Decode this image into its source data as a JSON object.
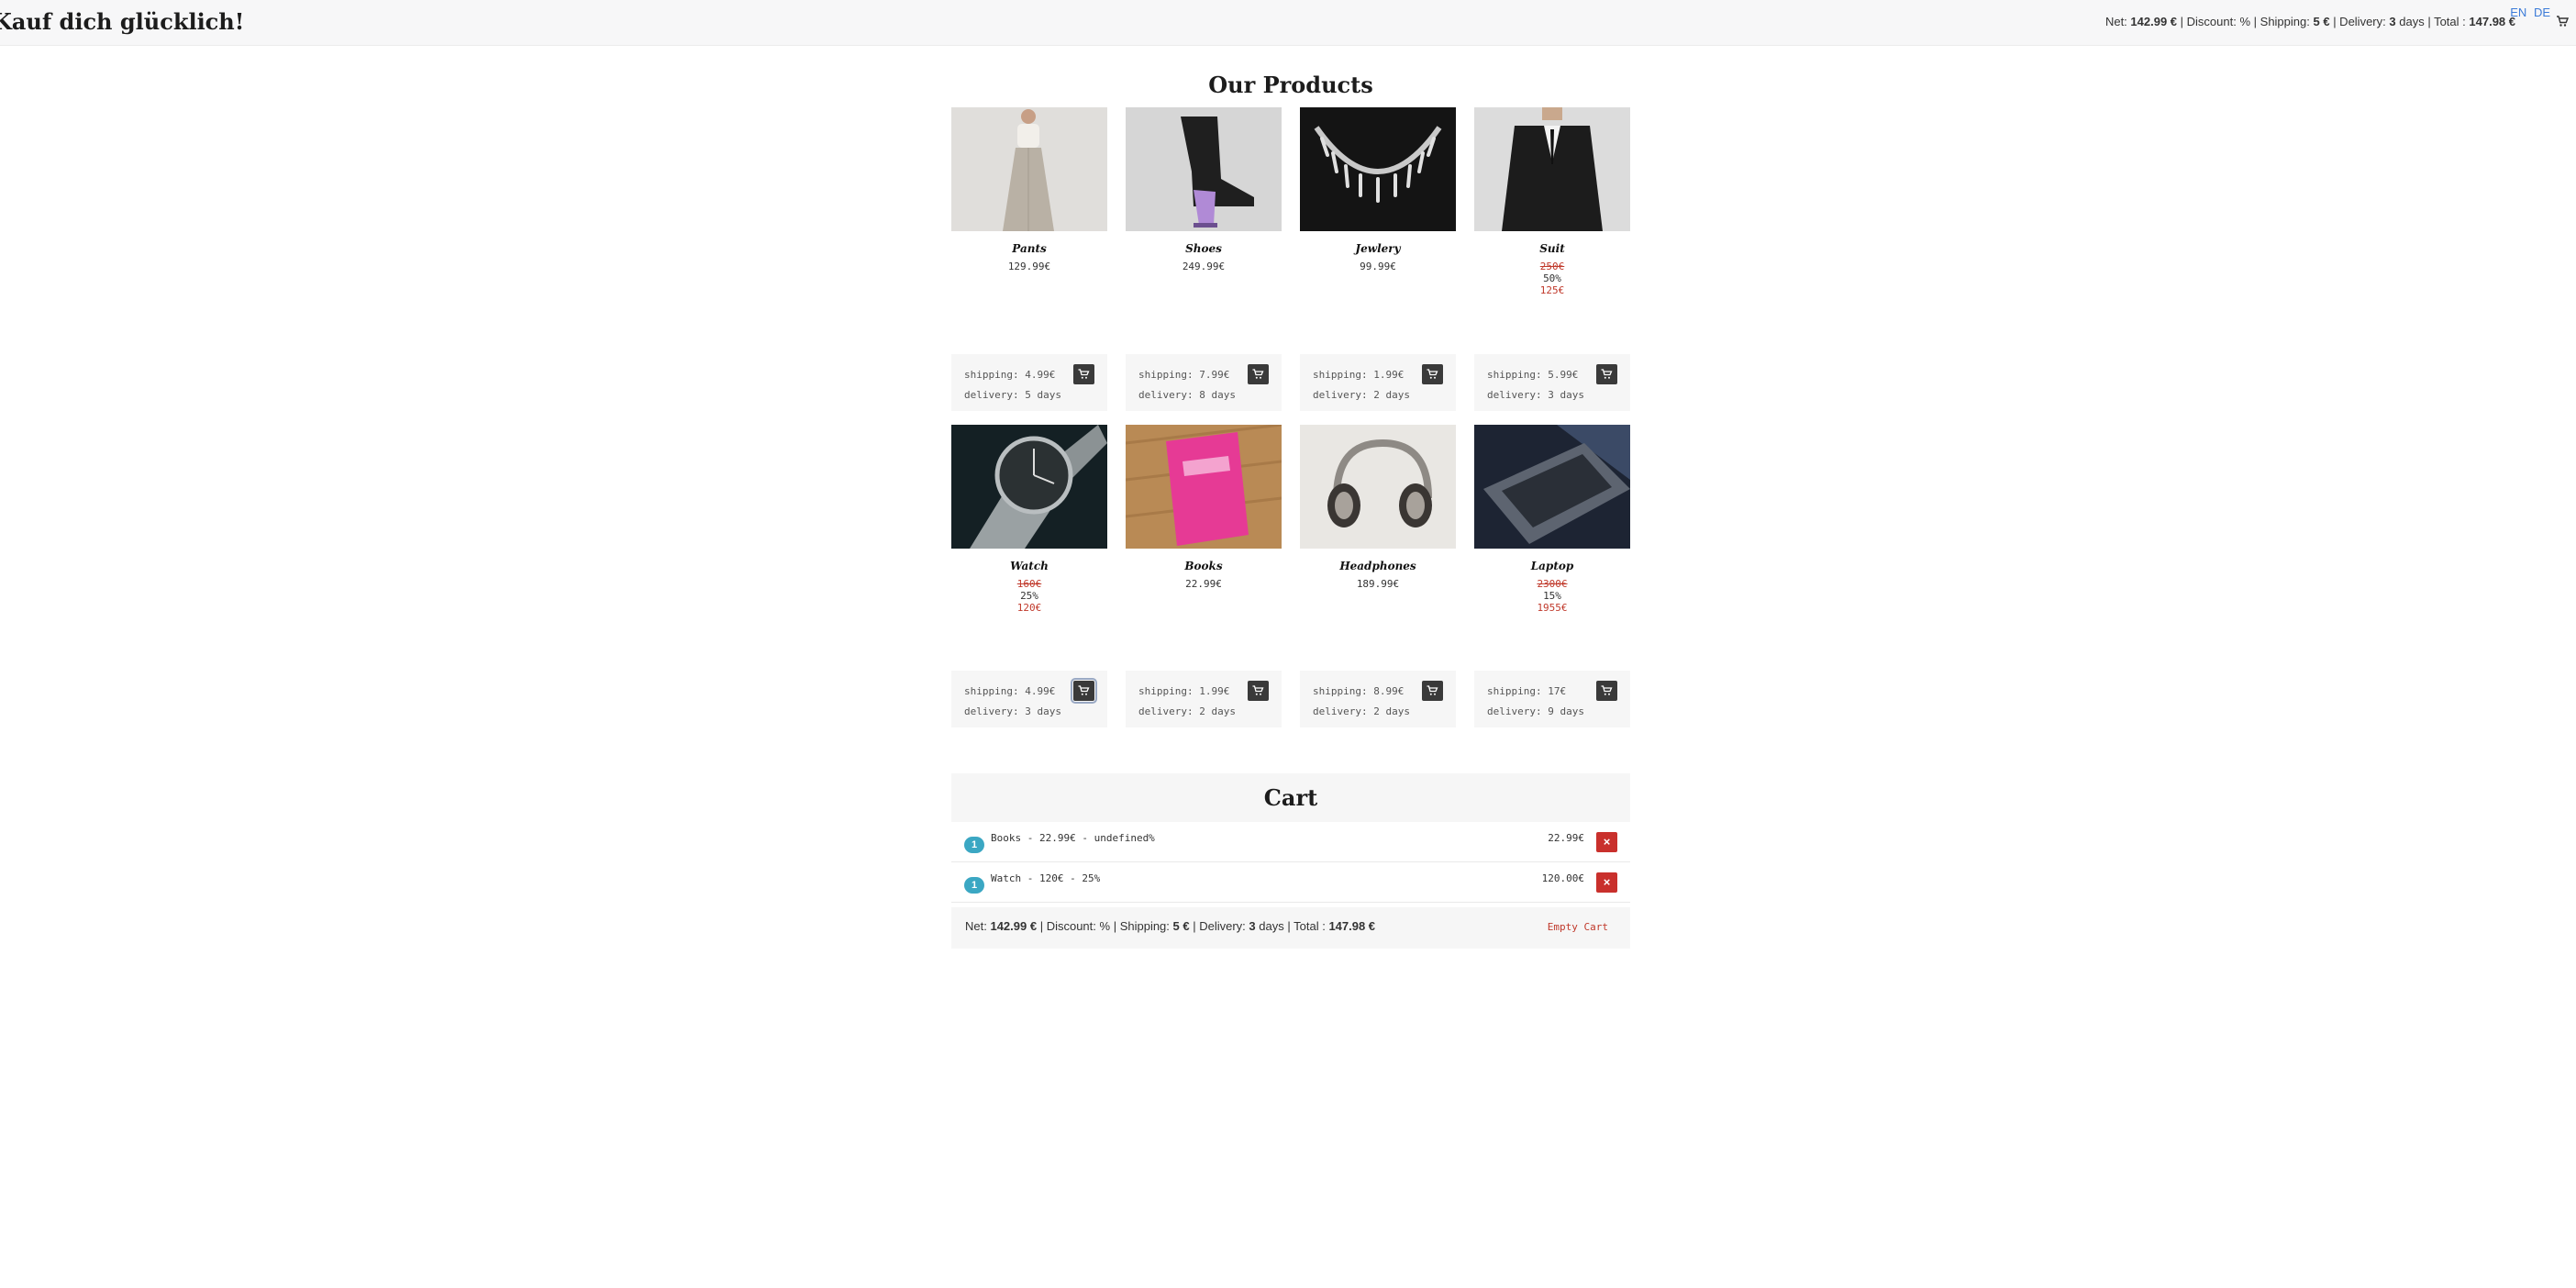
{
  "header": {
    "brand": "Kauf dich glücklich!",
    "summary": {
      "net_label": "Net:",
      "net_value": "142.99 €",
      "discount_label": "| Discount:",
      "discount_value": "%",
      "shipping_label": "| Shipping:",
      "shipping_value": "5 €",
      "delivery_label": "| Delivery:",
      "delivery_value": "3",
      "delivery_unit": "days",
      "total_label": "| Total :",
      "total_value": "147.98 €"
    },
    "languages": [
      "EN",
      "DE"
    ],
    "cart_icon": "shopping-cart-icon"
  },
  "products_heading": "Our Products",
  "products": [
    {
      "name": "Pants",
      "price": "129.99€",
      "shipping": "shipping: 4.99€",
      "delivery": "delivery: 5 days",
      "image": "pants-photo"
    },
    {
      "name": "Shoes",
      "price": "249.99€",
      "shipping": "shipping: 7.99€",
      "delivery": "delivery: 8 days",
      "image": "shoes-photo"
    },
    {
      "name": "Jewlery",
      "price": "99.99€",
      "shipping": "shipping: 1.99€",
      "delivery": "delivery: 2 days",
      "image": "necklace-photo"
    },
    {
      "name": "Suit",
      "old_price": "250€",
      "discount": "50%",
      "new_price": "125€",
      "shipping": "shipping: 5.99€",
      "delivery": "delivery: 3 days",
      "image": "suit-photo"
    },
    {
      "name": "Watch",
      "old_price": "160€",
      "discount": "25%",
      "new_price": "120€",
      "shipping": "shipping: 4.99€",
      "delivery": "delivery: 3 days",
      "image": "watch-photo"
    },
    {
      "name": "Books",
      "price": "22.99€",
      "shipping": "shipping: 1.99€",
      "delivery": "delivery: 2 days",
      "image": "book-photo"
    },
    {
      "name": "Headphones",
      "price": "189.99€",
      "shipping": "shipping: 8.99€",
      "delivery": "delivery: 2 days",
      "image": "headphones-photo"
    },
    {
      "name": "Laptop",
      "old_price": "2300€",
      "discount": "15%",
      "new_price": "1955€",
      "shipping": "shipping: 17€",
      "delivery": "delivery: 9 days",
      "image": "laptop-photo"
    }
  ],
  "cart": {
    "title": "Cart",
    "items": [
      {
        "qty": "1",
        "desc": "Books - 22.99€ - undefined%",
        "total": "22.99€"
      },
      {
        "qty": "1",
        "desc": "Watch - 120€ - 25%",
        "total": "120.00€"
      }
    ],
    "footer": {
      "net_label": "Net:",
      "net_value": "142.99 €",
      "discount_label": "| Discount:",
      "discount_value": "%",
      "shipping_label": "| Shipping:",
      "shipping_value": "5 €",
      "delivery_label": "| Delivery:",
      "delivery_value": "3",
      "delivery_unit": "days",
      "total_label": "| Total :",
      "total_value": "147.98 €"
    },
    "empty_label": "Empty Cart"
  },
  "colors": {
    "accent_red": "#c0392b",
    "badge_blue": "#3ba7c3",
    "remove_red": "#c9302c",
    "button_dark": "#3a3a3a",
    "lang_blue": "#3c7bd8"
  }
}
